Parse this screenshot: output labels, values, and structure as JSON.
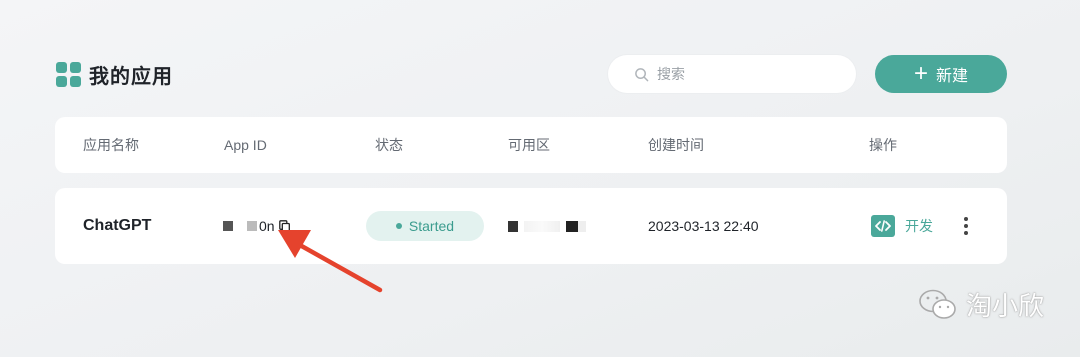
{
  "header": {
    "title": "我的应用",
    "search_placeholder": "搜索",
    "new_button_label": "新建"
  },
  "table": {
    "columns": [
      "应用名称",
      "App ID",
      "状态",
      "可用区",
      "创建时间",
      "操作"
    ],
    "rows": [
      {
        "app_name": "ChatGPT",
        "app_id_visible_suffix": "0n",
        "status": "Started",
        "created_at": "2023-03-13 22:40",
        "action_label": "开发"
      }
    ]
  },
  "watermark": {
    "text": "淘小欣"
  },
  "colors": {
    "accent": "#4aa89a",
    "status_bg": "#e3f2ef",
    "annotation_arrow": "#e5432d"
  },
  "icons": [
    "apps-grid-icon",
    "search-icon",
    "plus-icon",
    "copy-icon",
    "code-icon",
    "more-vertical-icon",
    "wechat-icon"
  ]
}
